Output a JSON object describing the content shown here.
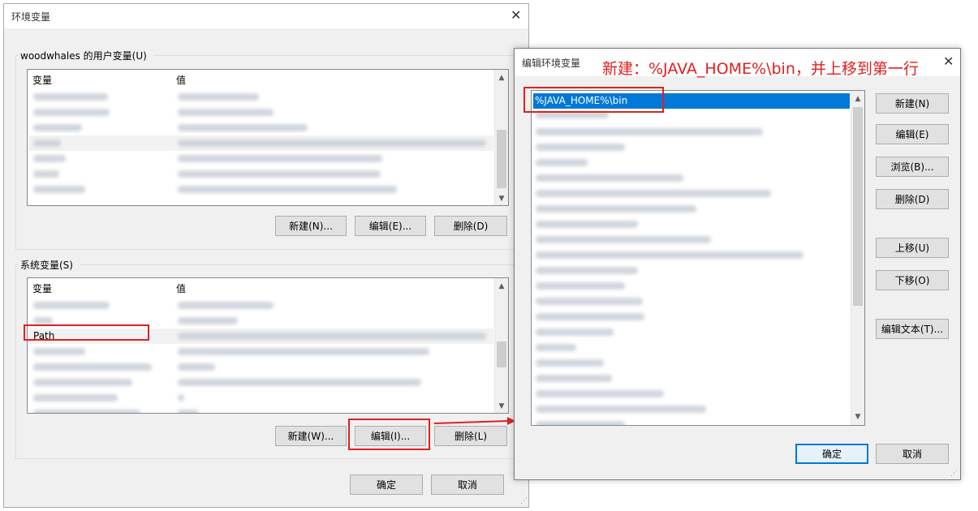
{
  "env_dialog": {
    "title": "环境变量",
    "close_glyph": "✕",
    "user_group_label": "woodwhales 的用户变量(U)",
    "user_table": {
      "headers": [
        "变量",
        "值"
      ],
      "row_count": 7
    },
    "user_buttons": {
      "new": "新建(N)...",
      "edit": "编辑(E)...",
      "delete": "删除(D)"
    },
    "system_group_label": "系统变量(S)",
    "system_table": {
      "headers": [
        "变量",
        "值"
      ],
      "path_row_label": "Path",
      "row_count": 8
    },
    "system_buttons": {
      "new": "新建(W)...",
      "edit": "编辑(I)...",
      "delete": "删除(L)"
    },
    "ok": "确定",
    "cancel": "取消"
  },
  "edit_dialog": {
    "title": "编辑环境变量",
    "annotation": "新建：%JAVA_HOME%\\bin，并上移到第一行",
    "close_glyph": "✕",
    "selected_entry": "%JAVA_HOME%\\bin",
    "buttons": {
      "new": "新建(N)",
      "edit": "编辑(E)",
      "browse": "浏览(B)...",
      "delete": "删除(D)",
      "move_up": "上移(U)",
      "move_down": "下移(O)",
      "edit_text": "编辑文本(T)..."
    },
    "ok": "确定",
    "cancel": "取消"
  },
  "colors": {
    "annotation_red": "#e02020",
    "selection_blue": "#0078d7"
  },
  "icons": {
    "scroll_up": "chevron-up-icon",
    "scroll_down": "chevron-down-icon",
    "close": "close-icon",
    "arrow": "arrow-right-icon"
  }
}
